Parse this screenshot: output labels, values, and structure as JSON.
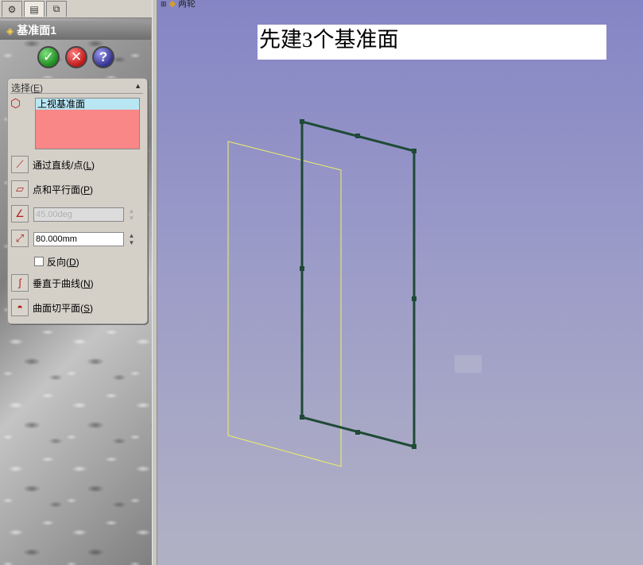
{
  "property_manager": {
    "title": "基准面1",
    "buttons": {
      "ok": "✓",
      "cancel": "✕",
      "help": "?"
    },
    "selection_group": {
      "header_prefix": "选择(",
      "header_key": "E",
      "header_suffix": ")",
      "selected_item": "上视基准面"
    },
    "options": [
      {
        "prefix": "通过直线/点(",
        "key": "L",
        "suffix": ")"
      },
      {
        "prefix": "点和平行面(",
        "key": "P",
        "suffix": ")"
      }
    ],
    "angle": {
      "value": "45.00deg"
    },
    "distance": {
      "value": "80.000mm"
    },
    "reverse": {
      "prefix": "反向(",
      "key": "D",
      "suffix": ")"
    },
    "options2": [
      {
        "prefix": "垂直于曲线(",
        "key": "N",
        "suffix": ")"
      },
      {
        "prefix": "曲面切平面(",
        "key": "S",
        "suffix": ")"
      }
    ]
  },
  "viewport": {
    "tree_label": "两轮",
    "annotation": "先建3个基准面"
  },
  "colors": {
    "selection_box": "#f98787",
    "selected_item": "#b9e6f3",
    "plane_outline": "#1f4a36",
    "preview_outline": "#f0f066"
  }
}
